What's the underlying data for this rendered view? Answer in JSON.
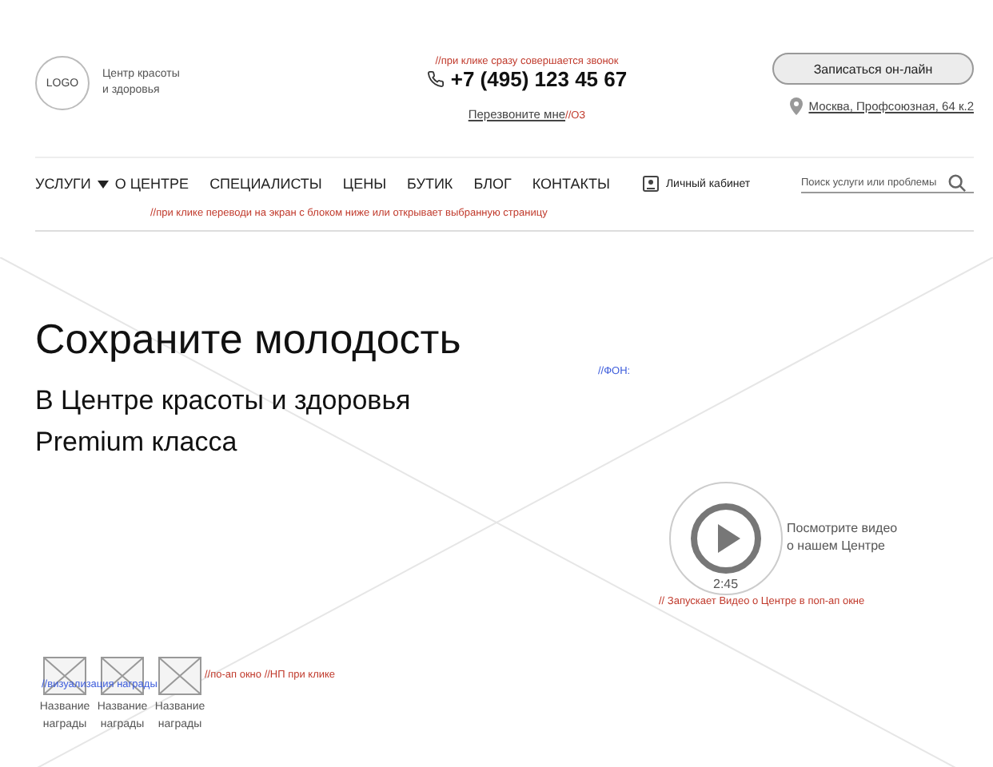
{
  "header": {
    "logo": "LOGO",
    "tagline": "Центр красоты и здоровья",
    "call_note": "//при клике сразу совершается звонок",
    "phone": "+7 (495) 123 45 67",
    "callback_link": "Перезвоните мне",
    "callback_note": "//ОЗ",
    "signup_button": "Записаться он-лайн",
    "address": "Москва, Профсоюзная, 64 к.2"
  },
  "nav": {
    "items": [
      {
        "label": "УСЛУГИ",
        "kind": "dropdown"
      },
      {
        "label": "О ЦЕНТРЕ",
        "kind": "link"
      },
      {
        "label": "СПЕЦИАЛИСТЫ",
        "kind": "link"
      },
      {
        "label": "ЦЕНЫ",
        "kind": "link"
      },
      {
        "label": "БУТИК",
        "kind": "link"
      },
      {
        "label": "БЛОГ",
        "kind": "link"
      },
      {
        "label": "КОНТАКТЫ",
        "kind": "link"
      }
    ],
    "account": "Личный кабинет",
    "search": {
      "placeholder": "Поиск услуги или проблемы"
    },
    "note": "//при клике переводи на экран с блоком ниже или открывает выбранную страницу"
  },
  "hero": {
    "background_note": "//ФОН:",
    "title": "Сохраните молодость",
    "subtitle_lines": [
      "В Центре красоты и здоровья",
      "Premium класса"
    ],
    "video": {
      "caption": "Посмотрите видео о нашем Центре",
      "duration": "2:45",
      "note": "// Запускает Видео о Центре в поп-ап окне"
    },
    "awards_note": "//визуализация награды",
    "awards_popup_note": "//по-ап окно //НП при клике",
    "awards": [
      {
        "name": "Название награды"
      },
      {
        "name": "Название награды"
      },
      {
        "name": "Название награды"
      }
    ]
  }
}
